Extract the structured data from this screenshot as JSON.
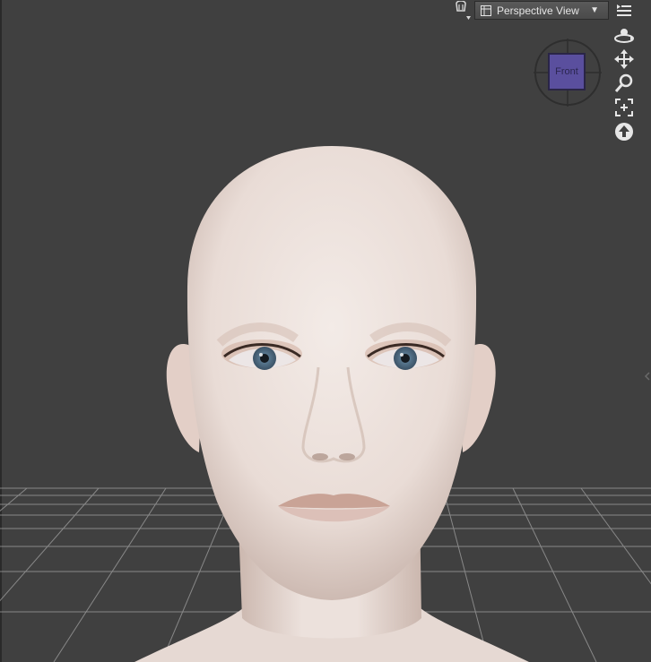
{
  "viewport": {
    "view_selector": {
      "label": "Perspective View",
      "caret": "▼",
      "icon": "viewport-layout-icon"
    },
    "view_cube": {
      "face_label": "Front",
      "face_color": "#5a4f9e"
    },
    "toolbar_icons": [
      "lamp-icon",
      "hamburger-menu-icon"
    ],
    "nav_tools": [
      "orbit-icon",
      "pan-icon",
      "zoom-icon",
      "frame-icon",
      "reset-view-icon"
    ],
    "colors": {
      "background": "#404040",
      "grid": "#9c9c9c",
      "skin": "#efe4df"
    }
  }
}
